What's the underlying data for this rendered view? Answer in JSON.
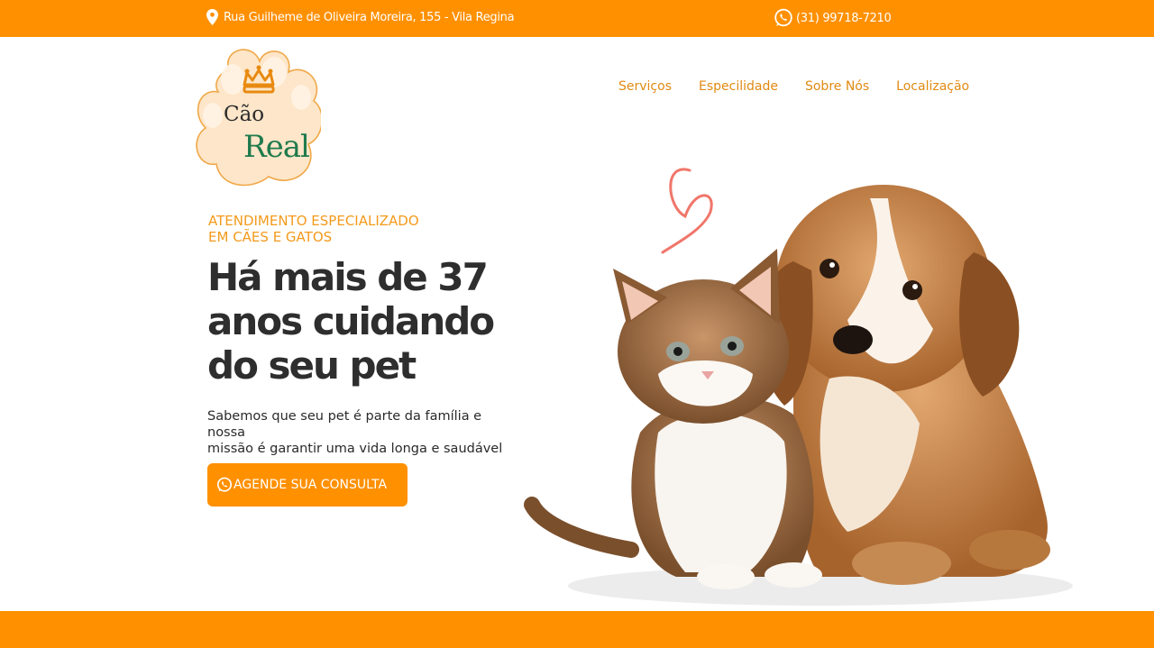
{
  "topbar": {
    "address": "Rua Guilheme de Oliveira Moreira, 155 - Vila Regina",
    "phone": "(31) 99718-7210",
    "location_icon": "map-pin-icon",
    "phone_icon": "whatsapp-icon"
  },
  "logo": {
    "line1": "Cão",
    "line2": "Real"
  },
  "nav": {
    "items": [
      "Serviços",
      "Especilidade",
      "Sobre Nós",
      "Localização"
    ]
  },
  "hero": {
    "kicker_line1": "ATENDIMENTO ESPECIALIZADO",
    "kicker_line2": "EM CÃES E GATOS",
    "headline_line1": "Há mais de 37",
    "headline_line2": "anos cuidando",
    "headline_line3": "do seu pet",
    "description_line1": "Sabemos que seu pet é parte da família e nossa",
    "description_line2": "missão é garantir uma vida longa e saudável",
    "cta_label": "AGENDE SUA CONSULTA",
    "cta_icon": "whatsapp-icon"
  },
  "colors": {
    "brand_orange": "#ff9000",
    "nav_text": "#e08a12",
    "headline_text": "#2e2e2e",
    "logo_green": "#1f7a4d"
  }
}
